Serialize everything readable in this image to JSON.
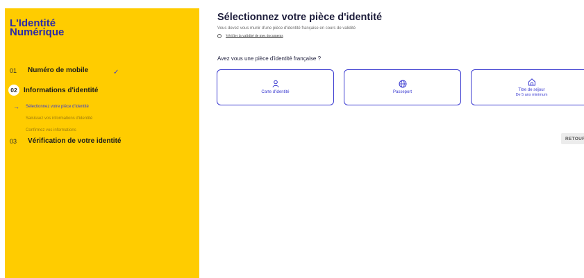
{
  "logo": {
    "line1": "L'Identité",
    "line2": "Numérique"
  },
  "steps": [
    {
      "num": "01",
      "label": "Numéro de mobile",
      "check": "✓"
    },
    {
      "num": "02",
      "label": "Informations d'identité"
    },
    {
      "num": "03",
      "label": "Vérification de votre identité"
    }
  ],
  "substeps": [
    {
      "label": "Sélectionnez votre pièce d'identité",
      "arrow": "→"
    },
    {
      "label": "Saisissez vos informations d'identité"
    },
    {
      "label": "Confirmez vos informations"
    }
  ],
  "main": {
    "title": "Sélectionnez votre pièce d'identité",
    "subtitle": "Vous devez vous munir d'une pièce d'identité française en cours de validité",
    "verify_link": "Vérifier la validité de mes documents",
    "question": "Avez vous une pièce d'identité française ?"
  },
  "cards": [
    {
      "label": "Carte d'identité",
      "icon": "person-icon"
    },
    {
      "label": "Passeport",
      "icon": "globe-icon"
    },
    {
      "label": "Titre de séjour",
      "sub": "De 5 ans minimum",
      "icon": "home-icon"
    }
  ],
  "back_button": "RETOUR",
  "colors": {
    "sidebar": "#ffcc00",
    "accent": "#3a3ad0",
    "logo": "#2a2aa8"
  }
}
